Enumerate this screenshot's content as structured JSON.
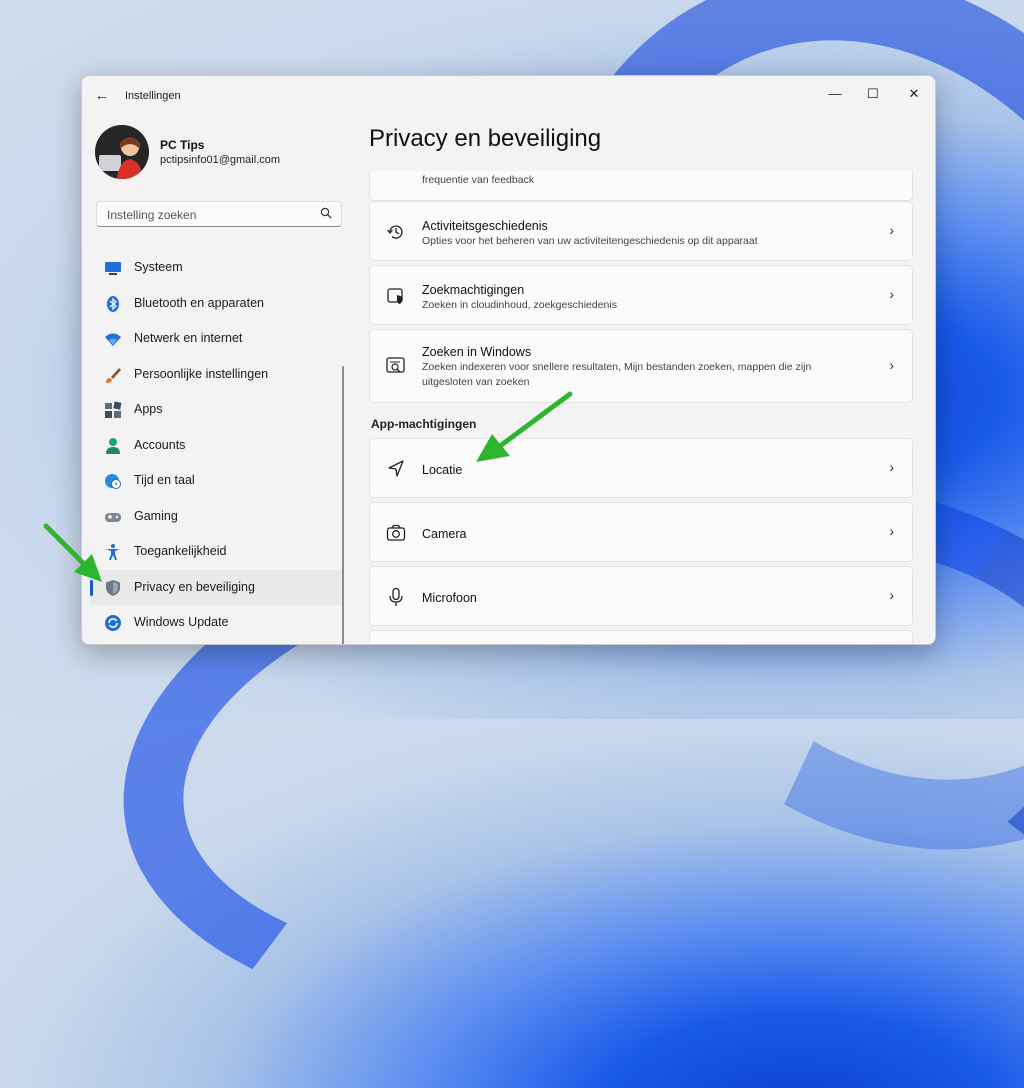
{
  "window": {
    "app_title": "Instellingen",
    "back_icon": "←",
    "controls": {
      "minimize": "—",
      "maximize": "☐",
      "close": "✕"
    }
  },
  "user": {
    "name": "PC Tips",
    "email": "pctipsinfo01@gmail.com"
  },
  "search": {
    "placeholder": "Instelling zoeken"
  },
  "sidebar": {
    "items": [
      {
        "label": "Systeem",
        "icon": "monitor-icon"
      },
      {
        "label": "Bluetooth en apparaten",
        "icon": "bluetooth-icon"
      },
      {
        "label": "Netwerk en internet",
        "icon": "wifi-icon"
      },
      {
        "label": "Persoonlijke instellingen",
        "icon": "brush-icon"
      },
      {
        "label": "Apps",
        "icon": "apps-icon"
      },
      {
        "label": "Accounts",
        "icon": "person-icon"
      },
      {
        "label": "Tijd en taal",
        "icon": "globe-clock-icon"
      },
      {
        "label": "Gaming",
        "icon": "gamepad-icon"
      },
      {
        "label": "Toegankelijkheid",
        "icon": "accessibility-icon"
      },
      {
        "label": "Privacy en beveiliging",
        "icon": "shield-icon",
        "selected": true
      },
      {
        "label": "Windows Update",
        "icon": "update-icon"
      }
    ]
  },
  "main": {
    "page_title": "Privacy en beveiliging",
    "partial_card_desc": "frequentie van feedback",
    "cards": [
      {
        "title": "Activiteitsgeschiedenis",
        "desc": "Opties voor het beheren van uw activiteitengeschiedenis op dit apparaat",
        "icon": "history-icon"
      },
      {
        "title": "Zoekmachtigingen",
        "desc": "Zoeken in cloudinhoud, zoekgeschiedenis",
        "icon": "search-permissions-icon"
      },
      {
        "title": "Zoeken in Windows",
        "desc": "Zoeken indexeren voor snellere resultaten, Mijn bestanden zoeken, mappen die zijn uitgesloten van zoeken",
        "icon": "search-windows-icon"
      }
    ],
    "section_header": "App-machtigingen",
    "permissions": [
      {
        "title": "Locatie",
        "icon": "location-icon"
      },
      {
        "title": "Camera",
        "icon": "camera-icon"
      },
      {
        "title": "Microfoon",
        "icon": "microphone-icon"
      }
    ],
    "chevron": "›"
  },
  "colors": {
    "accent": "#0a5fc8",
    "annotation_arrow": "#2db52d"
  }
}
